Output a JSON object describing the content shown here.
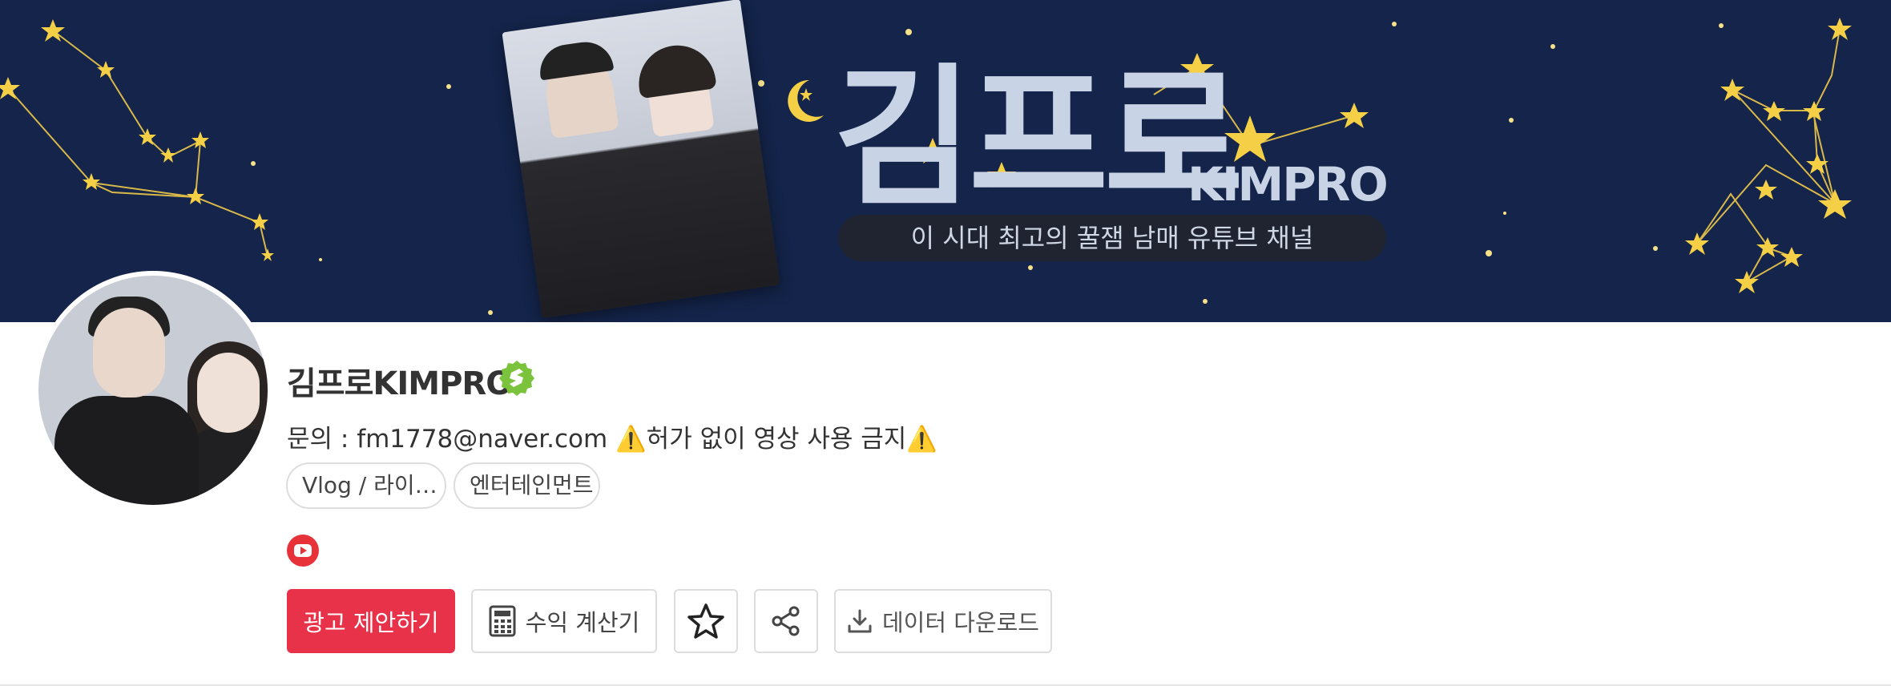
{
  "banner": {
    "brand_ko": "김프로",
    "brand_en": "KIMPRO",
    "tagline": "이 시대 최고의 꿀잼 남매 유튜브 채널"
  },
  "channel": {
    "name": "김프로KIMPRO",
    "description": "문의 : fm1778@naver.com ⚠️허가 없이 영상 사용 금지⚠️",
    "tags": [
      "Vlog / 라이…",
      "엔터테인먼트"
    ]
  },
  "actions": {
    "ad_label": "광고 제안하기",
    "calc_label": "수익 계산기",
    "download_label": "데이터 다운로드"
  },
  "icons": {
    "verified": "verified-badge-icon",
    "youtube": "youtube-icon",
    "calculator": "calculator-icon",
    "star": "star-icon",
    "share": "share-icon",
    "download": "download-icon"
  },
  "colors": {
    "banner_bg": "#14244a",
    "accent": "#e8324a",
    "verified_green": "#7bc23d",
    "star_gold": "#f5cf45"
  }
}
